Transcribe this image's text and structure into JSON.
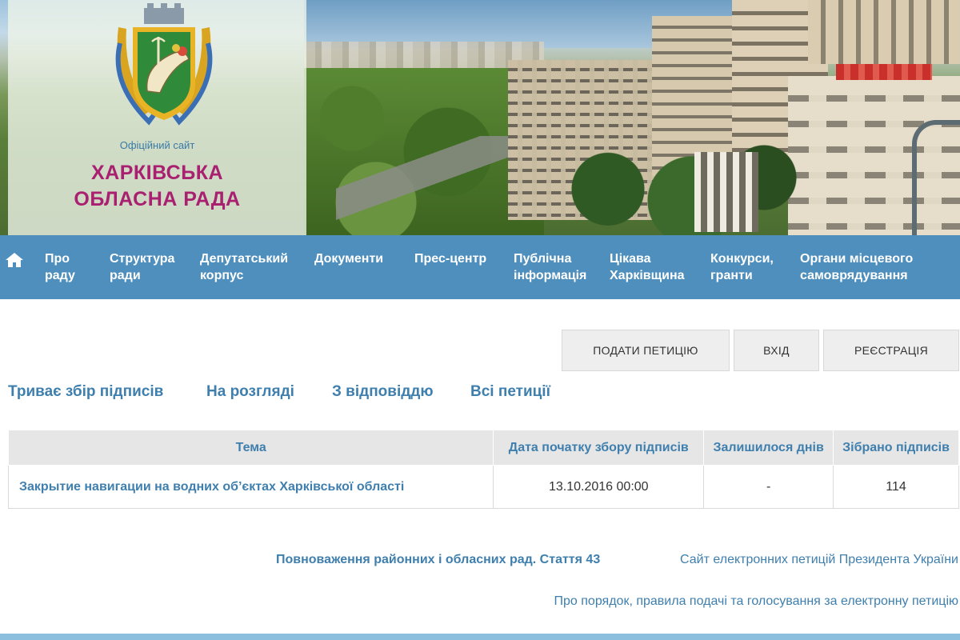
{
  "header": {
    "official_site": "Офіційний сайт",
    "council_name_line1": "ХАРКІВСЬКА",
    "council_name_line2": "ОБЛАСНА РАДА",
    "colors": {
      "brand": "#a8206f",
      "nav": "#4f8fbd",
      "link": "#3f7fae"
    }
  },
  "nav": {
    "home_icon": "home-icon",
    "items": [
      {
        "label": "Про\nраду"
      },
      {
        "label": "Структура\nради"
      },
      {
        "label": "Депутатський\nкорпус"
      },
      {
        "label": "Документи"
      },
      {
        "label": "Прес-центр"
      },
      {
        "label": "Публічна\nінформація"
      },
      {
        "label": "Цікава\nХарківщина"
      },
      {
        "label": "Конкурси,\nгранти"
      },
      {
        "label": "Органи місцевого\nсамоврядування"
      }
    ]
  },
  "actions": {
    "submit_petition": "ПОДАТИ ПЕТИЦІЮ",
    "login": "ВХІД",
    "register": "РЕЄСТРАЦІЯ"
  },
  "tabs": [
    {
      "label": "Триває збір підписів"
    },
    {
      "label": "На розгляді"
    },
    {
      "label": "З відповіддю"
    },
    {
      "label": "Всі петиції"
    }
  ],
  "table": {
    "headers": [
      "Тема",
      "Дата початку збору підписів",
      "Залишилося днів",
      "Зібрано підписів"
    ],
    "rows": [
      {
        "topic": "Закрытие навигации на водних об’єктах Харківської області",
        "start_date": "13.10.2016 00:00",
        "days_left": "-",
        "signatures": "114"
      }
    ]
  },
  "footer": {
    "powers_link": "Повноваження районних і обласних рад. Стаття 43",
    "president_link": "Сайт електронних петицій Президента України",
    "rules_link": "Про порядок, правила подачі та голосування за електронну петицію"
  }
}
